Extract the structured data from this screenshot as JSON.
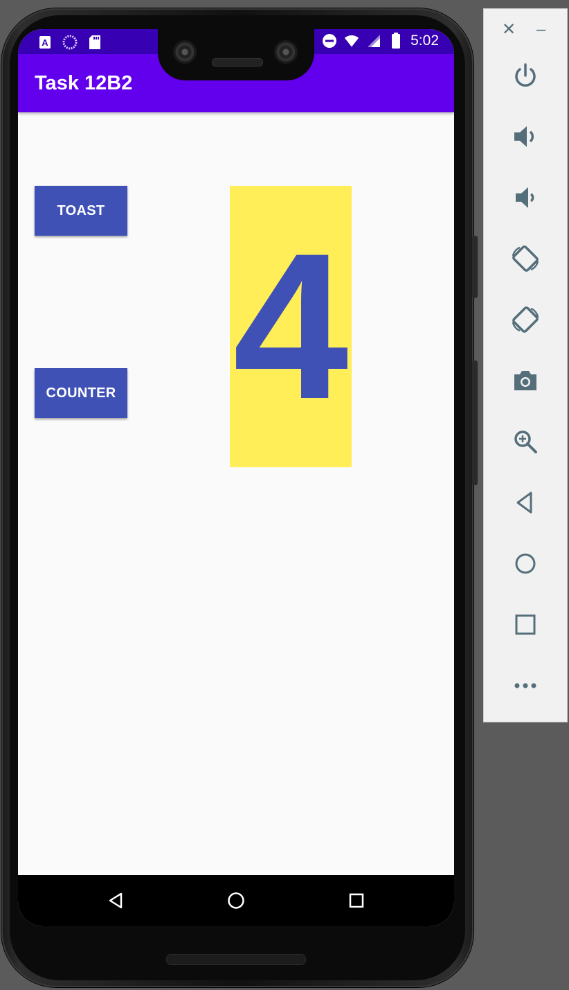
{
  "app": {
    "title": "Task 12B2"
  },
  "status_bar": {
    "time": "5:02"
  },
  "buttons": {
    "toast_label": "TOAST",
    "counter_label": "COUNTER"
  },
  "counter": {
    "value": "4"
  },
  "colors": {
    "status_bar": "#3700b3",
    "app_bar": "#6200ee",
    "button": "#3f51b5",
    "count_bg": "#ffee58",
    "count_text": "#3f51b5"
  },
  "emulator_controls": [
    "power-icon",
    "volume-up-icon",
    "volume-down-icon",
    "rotate-left-icon",
    "rotate-right-icon",
    "camera-icon",
    "zoom-icon",
    "back-icon",
    "home-icon",
    "overview-icon",
    "more-icon"
  ]
}
